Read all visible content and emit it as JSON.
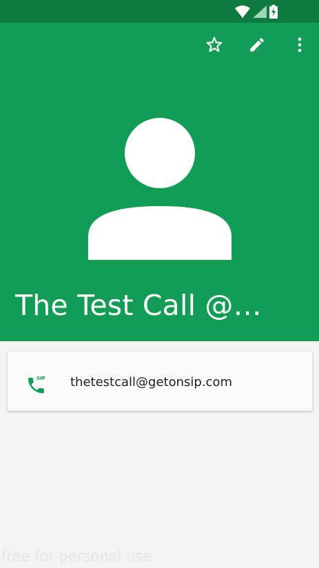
{
  "status_bar": {
    "icons": [
      "wifi-icon",
      "signal-icon",
      "battery-charging-icon"
    ]
  },
  "toolbar": {
    "actions": [
      "star-icon",
      "edit-pencil-icon",
      "more-vert-icon"
    ]
  },
  "contact": {
    "name": "The Test Call @…",
    "sip_address": "thetestcall@getonsip.com",
    "sip_icon_label": "SIP"
  },
  "watermark": "free for personal use",
  "colors": {
    "header": "#129c56",
    "status_bar": "#0f7a3d",
    "accent": "#0f9d58"
  }
}
